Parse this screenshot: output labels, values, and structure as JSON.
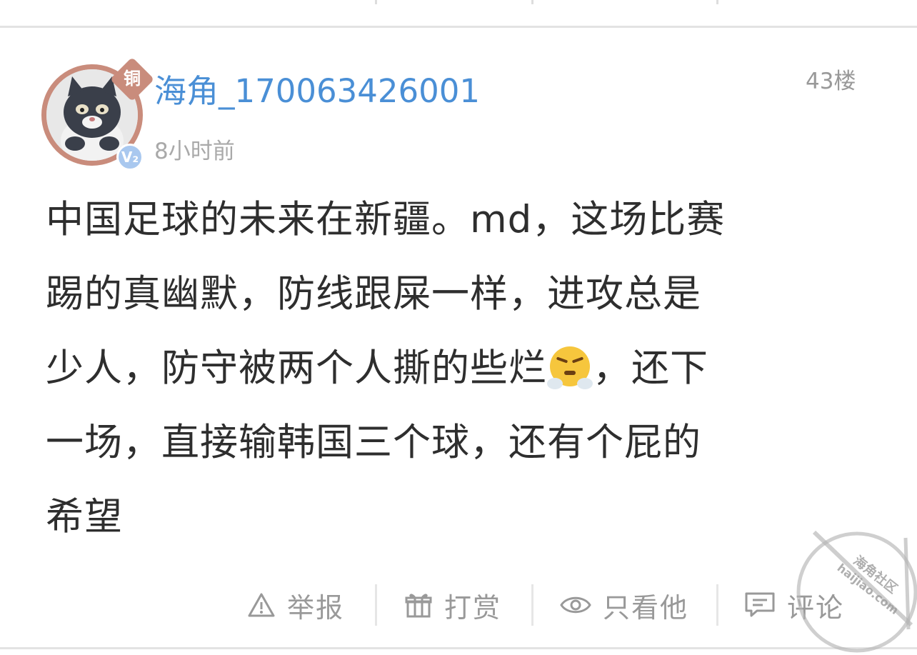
{
  "post": {
    "username": "海角_170063426001",
    "rank_badge": "铜",
    "level_badge": "V₂",
    "timestamp": "8小时前",
    "floor": "43楼",
    "content_lines": [
      "中国足球的未来在新疆。md，这场比赛",
      "踢的真幽默，防线跟屎一样，进攻总是",
      "少人，防守被两个人撕的些烂",
      "，还下",
      "一场，直接输韩国三个球，还有个屁的",
      "希望"
    ],
    "emoji": "huffing-face"
  },
  "actions": {
    "report_label": "举报",
    "reward_label": "打赏",
    "only_him_label": "只看他",
    "comment_label": "评论"
  },
  "watermark": {
    "text_top": "海角社区",
    "text_bottom": "haijiao.com"
  },
  "colors": {
    "username": "#4a8fd6",
    "badge": "#c98c7c",
    "level": "#a9c8ef",
    "muted": "#999999"
  }
}
